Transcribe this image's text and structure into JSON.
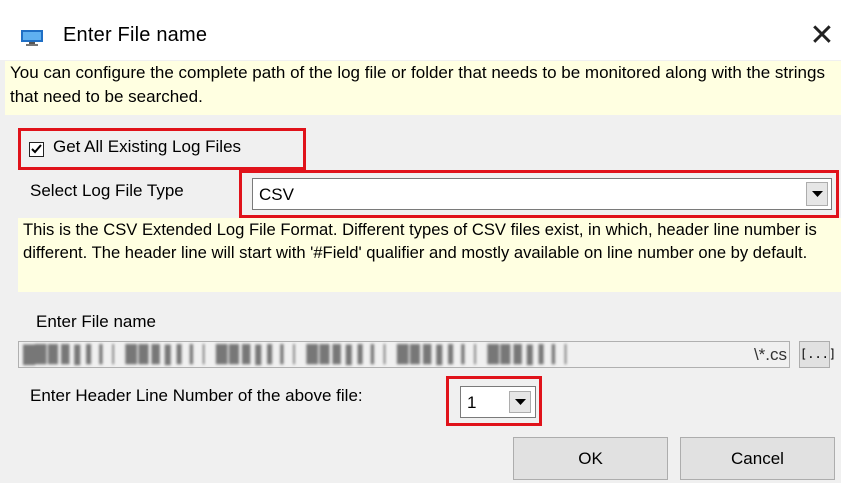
{
  "window": {
    "title": "Enter File name",
    "close_glyph": "✕",
    "icon": "monitor-app-icon"
  },
  "info_text": "You can configure the complete path of the log file or folder that needs to be monitored along with the strings that need to be searched.",
  "checkbox": {
    "label": "Get All Existing Log Files",
    "checked": true
  },
  "log_type": {
    "label": "Select Log File Type",
    "value": "CSV"
  },
  "description": "This is the CSV Extended Log File Format. Different types of CSV files exist, in which, header line number is different. The header line will start with '#Field' qualifier and mostly available on line number one by default.",
  "file": {
    "label": "Enter File name",
    "path_visible_tail": "\\*.cs",
    "browse_label": "[...]"
  },
  "header_line": {
    "label": "Enter Header Line Number of the above file:",
    "value": "1"
  },
  "buttons": {
    "ok": "OK",
    "cancel": "Cancel"
  },
  "colors": {
    "highlight": "#e0121a",
    "info_background": "#ffffe1",
    "dialog_background": "#f0f0f0"
  }
}
